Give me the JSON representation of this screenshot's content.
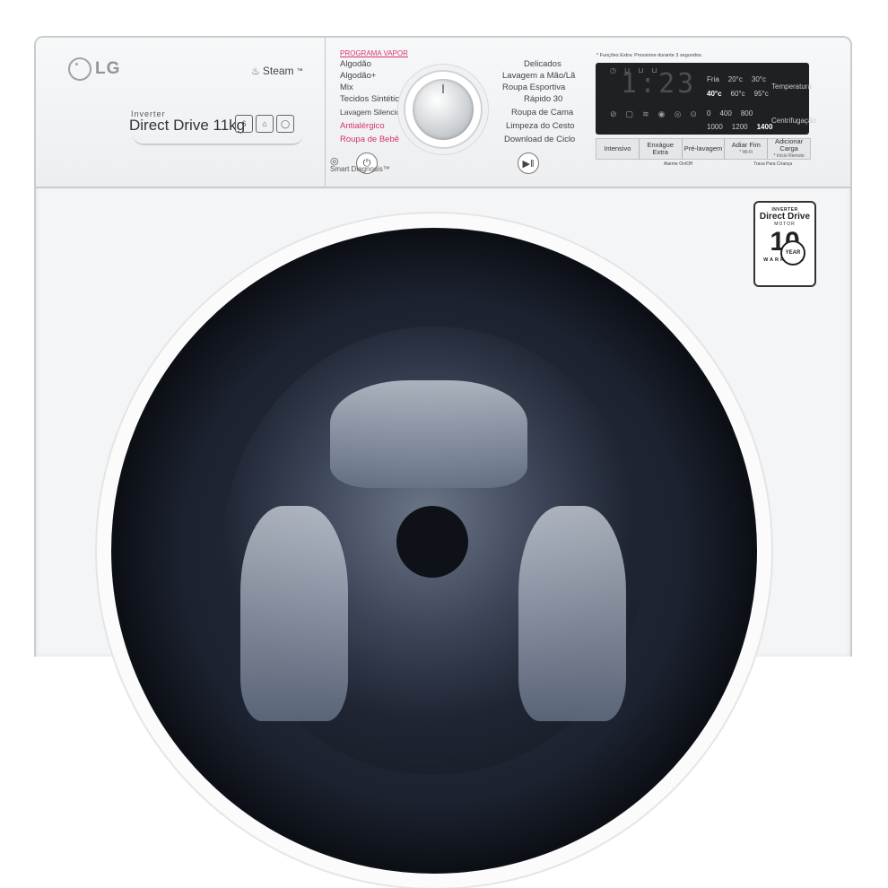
{
  "brand": {
    "logo": "LG",
    "steam": "Steam",
    "steam_tm": "™",
    "inverter": "Inverter",
    "model": "Direct Drive 11kg",
    "badges": [
      "6",
      "⌂",
      "◯"
    ]
  },
  "programs": {
    "title": "PROGRAMA VAPOR",
    "left": [
      {
        "label": "Algodão",
        "pink": false
      },
      {
        "label": "Algodão+",
        "pink": false
      },
      {
        "label": "Mix",
        "pink": false
      },
      {
        "label": "Tecidos Sintéticos",
        "pink": false
      },
      {
        "label": "Lavagem Silenciosa",
        "pink": false
      },
      {
        "label": "Antialérgico",
        "pink": true
      },
      {
        "label": "Roupa de Bebê",
        "pink": true
      }
    ],
    "right": [
      {
        "label": "Delicados"
      },
      {
        "label": "Lavagem a Mão/Lã"
      },
      {
        "label": "Roupa Esportiva"
      },
      {
        "label": "Rápido 30"
      },
      {
        "label": "Roupa de Cama"
      },
      {
        "label": "Limpeza do Cesto"
      },
      {
        "label": "Download de Ciclo"
      }
    ]
  },
  "controls": {
    "power_icon": "power-icon",
    "start_icon": "play-pause-icon",
    "smart_diagnosis": "Smart Diagnosis™"
  },
  "display": {
    "note": "* Funções Extra: Pressione durante 3 segundos.",
    "time": "1:23",
    "temperature": {
      "label": "Temperatura",
      "row1": [
        "Fria",
        "20°c",
        "30°c"
      ],
      "row2": [
        "40°c",
        "60°c",
        "95°c"
      ],
      "selected": "40°c"
    },
    "spin": {
      "label": "Centrifugação",
      "row1": [
        "0",
        "400",
        "800"
      ],
      "row2": [
        "1000",
        "1200",
        "1400"
      ],
      "selected": "1400"
    },
    "options": [
      {
        "label": "Intensivo",
        "sub": ""
      },
      {
        "label": "Enxágue Extra",
        "sub": ""
      },
      {
        "label": "Pré-lavagem",
        "sub": ""
      },
      {
        "label": "Adiar Fim",
        "sub": "* Wi-Fi"
      },
      {
        "label": "Adicionar Carga",
        "sub": "* Início Remoto"
      }
    ],
    "hint_alarm": "Alarme On/Off",
    "hint_lock": "Trava Para Criança"
  },
  "warranty": {
    "line1": "INVERTER",
    "line2": "Direct Drive",
    "line3": "MOTOR",
    "number": "10",
    "year": "YEAR",
    "line4": "WARRANTY"
  }
}
